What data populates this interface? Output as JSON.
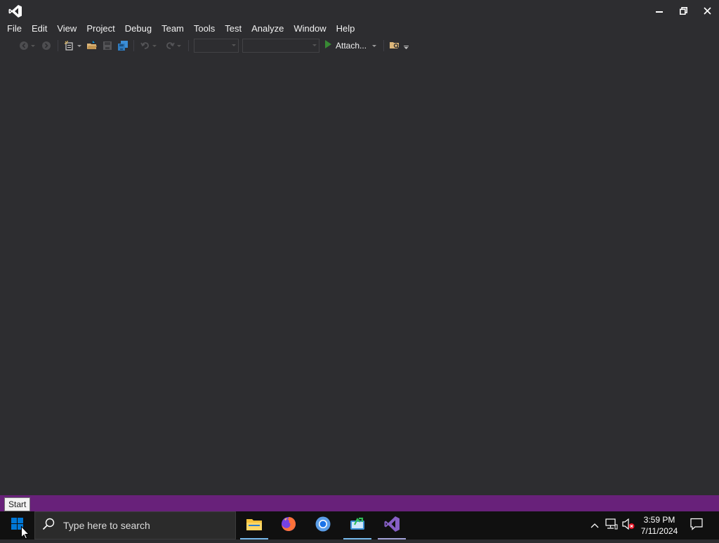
{
  "window": {
    "logo_icon": "visual-studio-logo-icon",
    "controls": [
      "minimize-icon",
      "restore-icon",
      "close-icon"
    ]
  },
  "menu": {
    "items": [
      {
        "label": "File"
      },
      {
        "label": "Edit"
      },
      {
        "label": "View"
      },
      {
        "label": "Project"
      },
      {
        "label": "Debug"
      },
      {
        "label": "Team"
      },
      {
        "label": "Tools"
      },
      {
        "label": "Test"
      },
      {
        "label": "Analyze"
      },
      {
        "label": "Window"
      },
      {
        "label": "Help"
      }
    ]
  },
  "toolbar": {
    "icons": [
      "navigate-back-icon",
      "navigate-forward-icon",
      "new-project-icon",
      "open-file-icon",
      "save-icon",
      "save-all-icon",
      "undo-icon",
      "redo-icon",
      "play-icon",
      "find-in-files-icon"
    ],
    "attach_label": "Attach...",
    "solution_configuration": "",
    "solution_platform": ""
  },
  "statusbar": {
    "color": "#68217a"
  },
  "tooltip": {
    "text": "Start"
  },
  "taskbar": {
    "search_placeholder": "Type here to search",
    "apps": [
      "file-explorer-icon",
      "firefox-icon",
      "chrome-icon",
      "teams-share-icon",
      "visual-studio-icon"
    ],
    "tray_icons": [
      "show-hidden-icons-chevron-icon",
      "network-icon",
      "volume-muted-icon",
      "notifications-icon"
    ],
    "time": "3:59 PM",
    "date": "7/11/2024"
  },
  "colors": {
    "background": "#2d2d30",
    "text": "#f1f1f1",
    "accent": "#68217a",
    "play": "#388a34"
  }
}
